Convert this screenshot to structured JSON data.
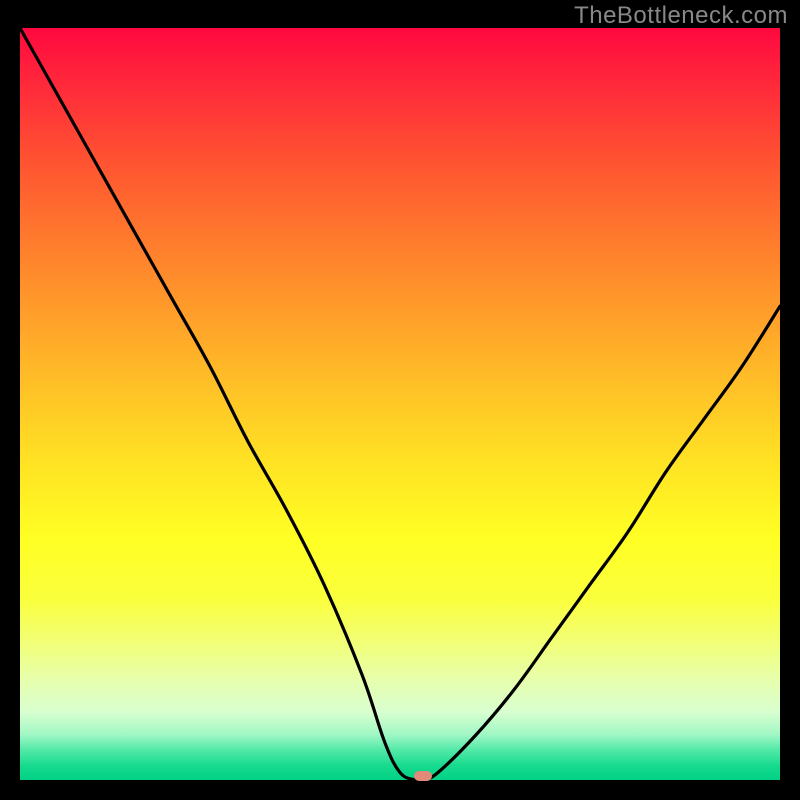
{
  "watermark": "TheBottleneck.com",
  "chart_data": {
    "type": "line",
    "title": "",
    "xlabel": "",
    "ylabel": "",
    "xlim": [
      0,
      100
    ],
    "ylim": [
      0,
      100
    ],
    "x": [
      0,
      5,
      10,
      15,
      20,
      25,
      30,
      35,
      40,
      45,
      48,
      50,
      52,
      53,
      55,
      60,
      65,
      70,
      75,
      80,
      85,
      90,
      95,
      100
    ],
    "y": [
      100,
      91,
      82,
      73,
      64,
      55,
      45,
      36,
      26,
      14,
      5,
      1,
      0,
      0,
      1,
      6,
      12,
      19,
      26,
      33,
      41,
      48,
      55,
      63
    ],
    "marker": {
      "x": 53,
      "y": 0.5
    },
    "gradient_stops": [
      {
        "pos": 0,
        "color": "#ff083f"
      },
      {
        "pos": 50,
        "color": "#ffc227"
      },
      {
        "pos": 70,
        "color": "#ffff24"
      },
      {
        "pos": 100,
        "color": "#00d184"
      }
    ]
  }
}
